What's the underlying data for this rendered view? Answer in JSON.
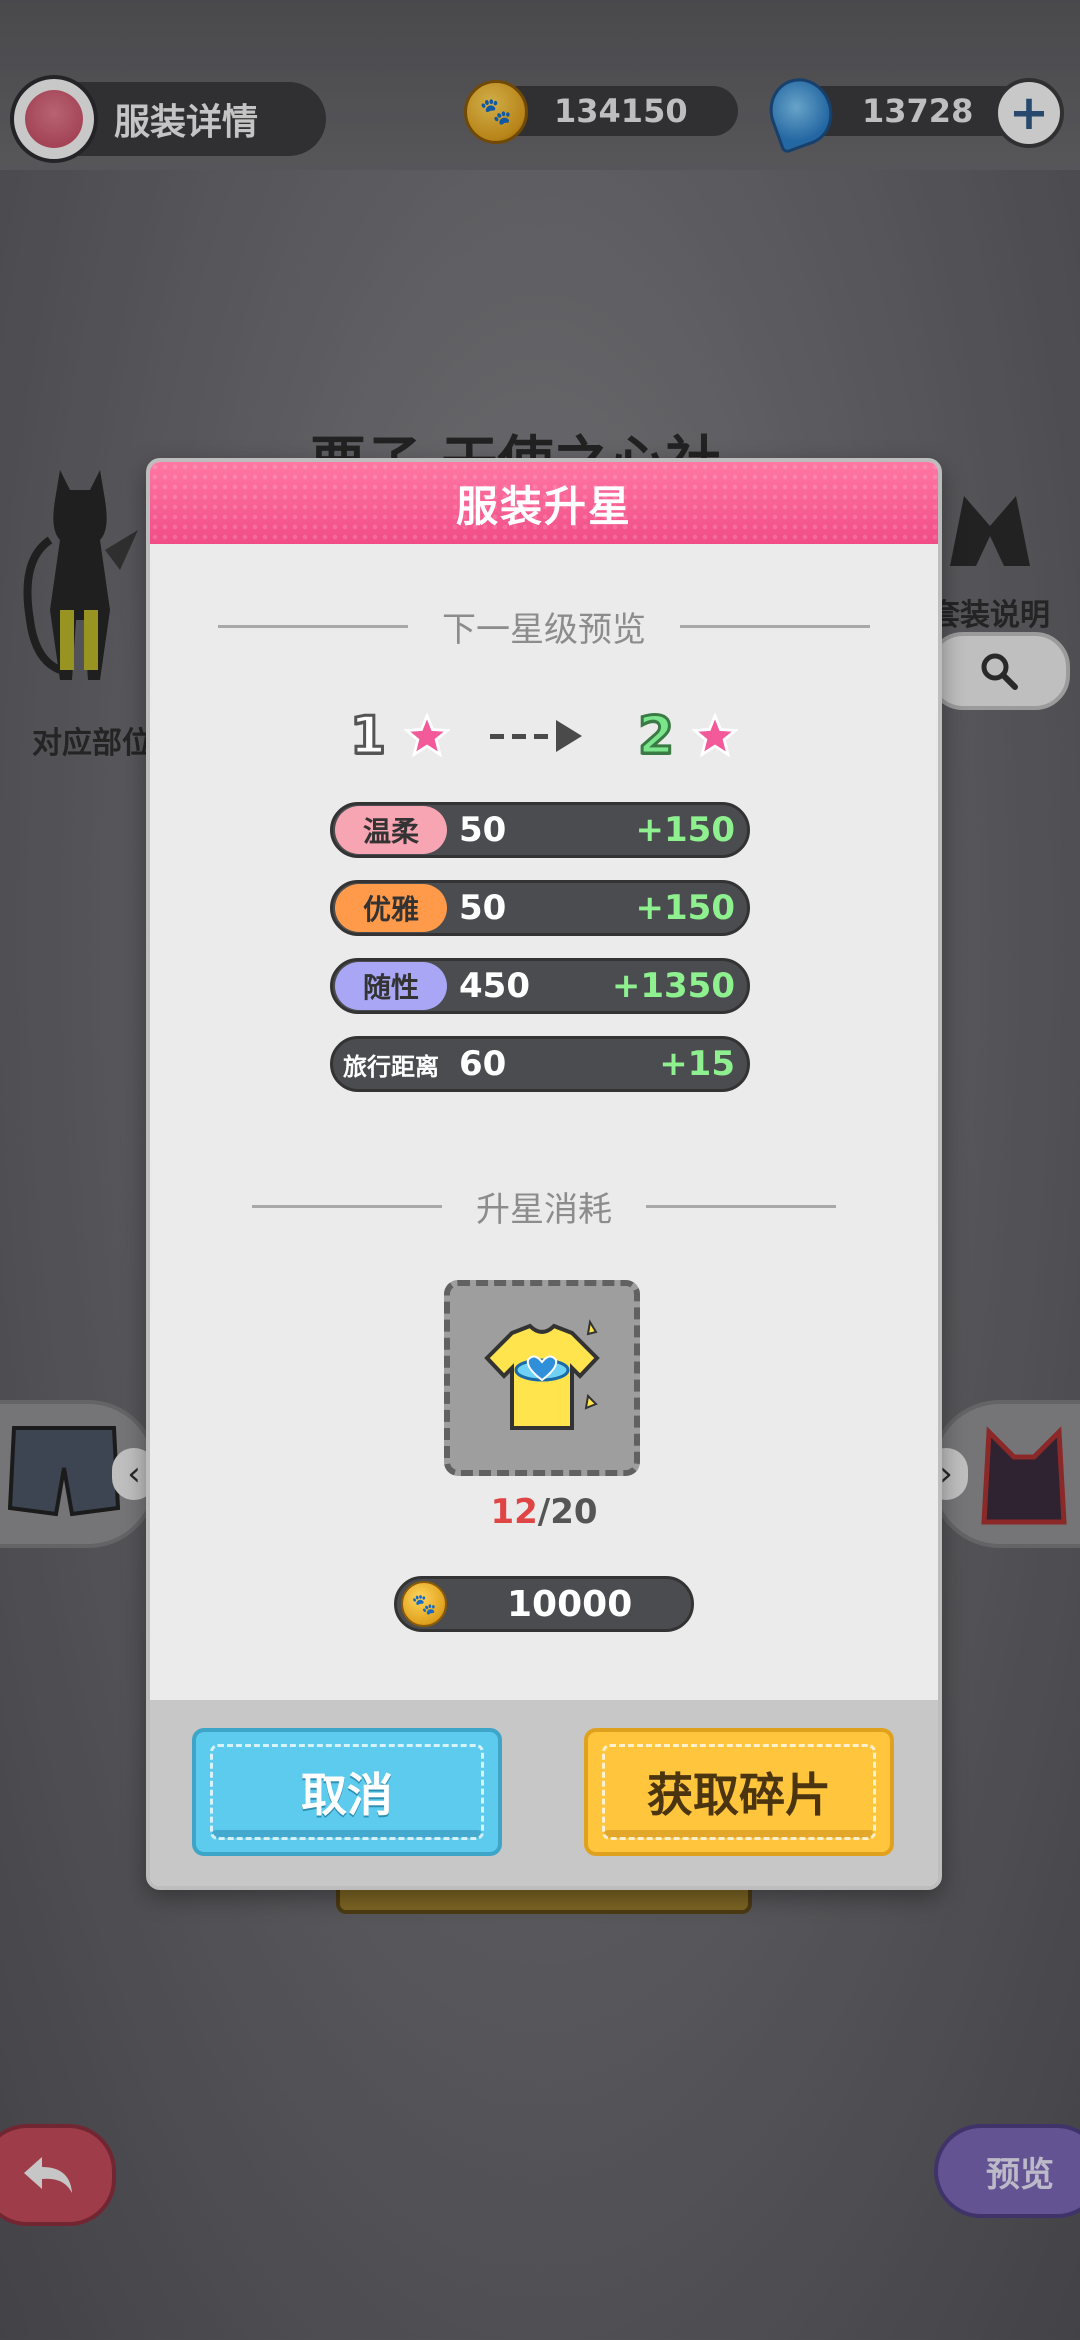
{
  "header": {
    "title": "服装详情",
    "coins": "134150",
    "gems": "13728",
    "add_symbol": "+"
  },
  "background": {
    "outfit_name": "栗子 干使之心社",
    "left_label": "对应部位",
    "right_label": "套装说明"
  },
  "modal": {
    "title": "服装升星",
    "preview_title": "下一星级预览",
    "current_star": "1",
    "next_star": "2",
    "stats": [
      {
        "label": "温柔",
        "value": "50",
        "bonus": "+150",
        "color": "#f7a5b3"
      },
      {
        "label": "优雅",
        "value": "50",
        "bonus": "+150",
        "color": "#ff9a4a"
      },
      {
        "label": "随性",
        "value": "450",
        "bonus": "+1350",
        "color": "#a9a7f5"
      },
      {
        "label": "旅行距离",
        "value": "60",
        "bonus": "+15",
        "color": "#4a4c4f"
      }
    ],
    "cost_title": "升星消耗",
    "shard_have": "12",
    "shard_need": "/20",
    "coin_cost": "10000",
    "cancel_label": "取消",
    "get_shards_label": "获取碎片"
  },
  "bottom": {
    "preview_label": "预览"
  },
  "colors": {
    "header_pink": "#f14c86",
    "cancel_blue": "#5ccbee",
    "get_yellow": "#ffc53d",
    "bonus_green": "#8ef08e",
    "shard_red": "#e04545"
  }
}
